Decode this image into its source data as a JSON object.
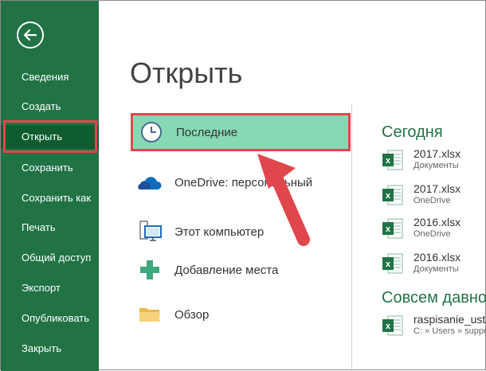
{
  "sidebar": {
    "back_icon": "arrow-left-icon",
    "items": [
      {
        "label": "Сведения"
      },
      {
        "label": "Создать"
      },
      {
        "label": "Открыть"
      },
      {
        "label": "Сохранить"
      },
      {
        "label": "Сохранить как"
      },
      {
        "label": "Печать"
      },
      {
        "label": "Общий доступ"
      },
      {
        "label": "Экспорт"
      },
      {
        "label": "Опубликовать"
      },
      {
        "label": "Закрыть"
      }
    ]
  },
  "main": {
    "title": "Открыть",
    "places": [
      {
        "label": "Последние",
        "icon": "clock-icon"
      },
      {
        "label": "OneDrive: персональный",
        "icon": "cloud-icon"
      },
      {
        "label": "Этот компьютер",
        "icon": "computer-icon"
      },
      {
        "label": "Добавление места",
        "icon": "plus-icon"
      },
      {
        "label": "Обзор",
        "icon": "folder-icon"
      }
    ]
  },
  "recent": {
    "today_title": "Сегодня",
    "long_ago_title": "Совсем давно",
    "files": [
      {
        "name": "2017.xlsx",
        "location": "Документы"
      },
      {
        "name": "2017.xlsx",
        "location": "OneDrive"
      },
      {
        "name": "2016.xlsx",
        "location": "OneDrive"
      },
      {
        "name": "2016.xlsx",
        "location": "Документы"
      }
    ],
    "old_files": [
      {
        "name": "raspisanie_ust",
        "location": "C: » Users » suppo"
      }
    ]
  },
  "colors": {
    "excel_green": "#217346",
    "highlight": "#87d9b4",
    "annotation_red": "#e0474c"
  }
}
